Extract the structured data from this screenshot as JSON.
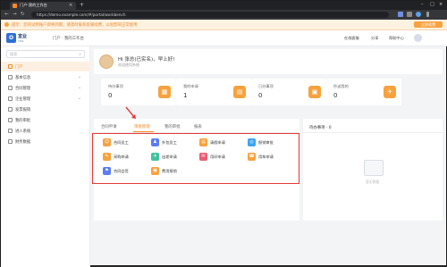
{
  "browser": {
    "tab_title": "门户-我的工作台",
    "url": "https://demo.example.com/#/portal/workbench",
    "close_glyph": "×",
    "new_tab_glyph": "+",
    "min_glyph": "–",
    "max_glyph": "□",
    "back_glyph": "←",
    "forward_glyph": "→",
    "reload_glyph": "↻"
  },
  "notice": {
    "text": "提示：您的试用账户即将到期，请及时联系客服续费，以免影响正常使用",
    "button": "立即续费"
  },
  "header": {
    "logo_mark": "O",
    "logo_name": "宜业",
    "logo_sub": "YEJA",
    "breadcrumb": "门户 · 我的工作台",
    "items": [
      "在线客服",
      "分享",
      "帮助中心"
    ]
  },
  "sidebar": {
    "search_placeholder": "搜索",
    "search_icon": "⌕",
    "items": [
      {
        "label": "门户",
        "active": true,
        "arrow": ""
      },
      {
        "label": "基本信息",
        "active": false,
        "arrow": "⌄"
      },
      {
        "label": "合同管理",
        "active": false,
        "arrow": "⌄"
      },
      {
        "label": "企业管理",
        "active": false,
        "arrow": "⌄"
      },
      {
        "label": "发票报销",
        "active": false,
        "arrow": ""
      },
      {
        "label": "我的审批",
        "active": false,
        "arrow": ""
      },
      {
        "label": "进入系统",
        "active": false,
        "arrow": ""
      },
      {
        "label": "财务数据",
        "active": false,
        "arrow": ""
      }
    ]
  },
  "welcome": {
    "title": "Hi 张总(已实名)，早上好!",
    "subtitle": "欢迎使用系统"
  },
  "stats": [
    {
      "label": "待办事项",
      "value": "0",
      "icon": "▦",
      "color": "#f7a23e"
    },
    {
      "label": "我的申请",
      "value": "1",
      "icon": "▤",
      "color": "#f7a23e"
    },
    {
      "label": "已办事项",
      "value": "0",
      "icon": "▣",
      "color": "#f7a23e"
    },
    {
      "label": "抄送我的",
      "value": "0",
      "icon": "✈",
      "color": "#f7a23e"
    }
  ],
  "panel": {
    "tabs": [
      {
        "label": "合同申请",
        "active": false
      },
      {
        "label": "审批管理",
        "active": true
      },
      {
        "label": "我的审批",
        "active": false
      },
      {
        "label": "报表",
        "active": false
      }
    ],
    "apps": [
      {
        "label": "合同员工",
        "icon": "☺",
        "color": "#f7a23e"
      },
      {
        "label": "外包员工",
        "icon": "♟",
        "color": "#5b7cf5"
      },
      {
        "label": "请假申请",
        "icon": "▤",
        "color": "#f7a23e"
      },
      {
        "label": "报销审批",
        "icon": "◎",
        "color": "#3ba3f2"
      },
      {
        "label": "采购申请",
        "icon": "✎",
        "color": "#f7a23e"
      },
      {
        "label": "出差申请",
        "icon": "✈",
        "color": "#44c2a0"
      },
      {
        "label": "用印申请",
        "icon": "✉",
        "color": "#e85d75"
      },
      {
        "label": "用车申请",
        "icon": "☎",
        "color": "#f7a23e"
      },
      {
        "label": "合同会签",
        "icon": "⚑",
        "color": "#5b7cf5"
      },
      {
        "label": "费用报销",
        "icon": "▣",
        "color": "#f7a23e"
      }
    ]
  },
  "right_panel": {
    "title": "待办事项 · 0",
    "empty": "暂无数据"
  }
}
